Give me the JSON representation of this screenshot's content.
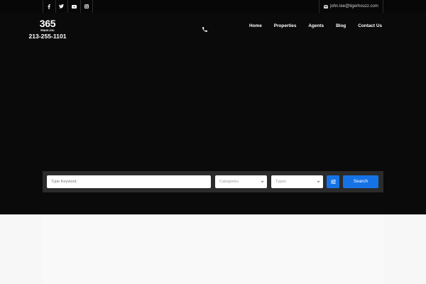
{
  "topbar": {
    "social_icons": [
      "facebook-icon",
      "twitter-icon",
      "youtube-icon",
      "instagram-icon"
    ],
    "email": "john.lee@tigerhouzz.com"
  },
  "logo": {
    "big": "365",
    "small": "Haus.inc",
    "phone": "213-255-1101"
  },
  "nav": {
    "items": [
      "Home",
      "Properties",
      "Agents",
      "Blog",
      "Contact Us"
    ]
  },
  "search": {
    "keyword_placeholder": "Type Keyword",
    "categories_label": "Categories",
    "types_label": "Types",
    "search_label": "Search"
  },
  "colors": {
    "accent": "#1673e6",
    "hero_bg": "#0a0a0a",
    "panel_bg": "#2b2b2b"
  }
}
